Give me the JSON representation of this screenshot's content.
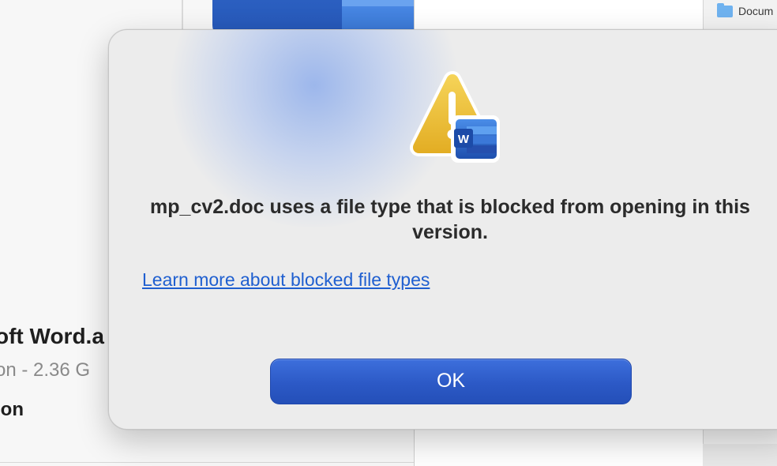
{
  "background": {
    "app_name": "oft Word.a",
    "app_meta": "on - 2.36 G",
    "section_label": "ion",
    "sidebar_item": "Docum",
    "sidebar_item_icon": "folder-icon"
  },
  "dialog": {
    "icon": "warning-word-icon",
    "message": "mp_cv2.doc uses a file type that is blocked from opening in this version.",
    "link_text": "Learn more about blocked file types",
    "ok_label": "OK"
  },
  "colors": {
    "accent_button": "#2c59c6",
    "link": "#1f5fd0",
    "warning_yellow": "#f0c338",
    "word_blue": "#2b579a"
  }
}
